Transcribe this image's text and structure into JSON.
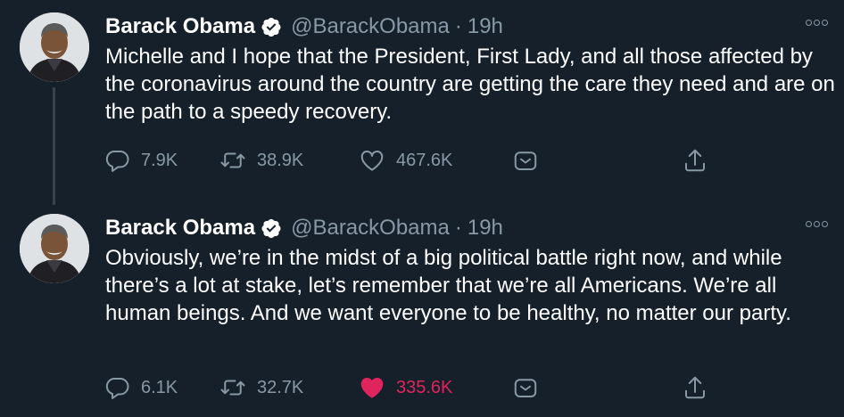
{
  "tweets": [
    {
      "name": "Barack Obama",
      "handle": "@BarackObama",
      "separator": "·",
      "time": "19h",
      "text": "Michelle and I hope that the President, First Lady, and all those affected by the coronavirus around the country are getting the care they need and are on the path to a speedy recovery.",
      "replies": "7.9K",
      "retweets": "38.9K",
      "likes": "467.6K",
      "liked": false
    },
    {
      "name": "Barack Obama",
      "handle": "@BarackObama",
      "separator": "·",
      "time": "19h",
      "text": "Obviously, we’re in the midst of a big political battle right now, and while there’s a lot at stake, let’s remember that we’re all Americans. We’re all human beings. And we want everyone to be healthy, no matter our party.",
      "replies": "6.1K",
      "retweets": "32.7K",
      "likes": "335.6K",
      "liked": true
    }
  ],
  "colors": {
    "background": "#15202b",
    "secondary_text": "#8899a6",
    "verified_blue": "#ffffff",
    "like_pink": "#e0245e"
  },
  "icons": [
    "verified-badge-icon",
    "more-icon",
    "reply-icon",
    "retweet-icon",
    "like-icon",
    "share-icon",
    "upload-icon"
  ]
}
